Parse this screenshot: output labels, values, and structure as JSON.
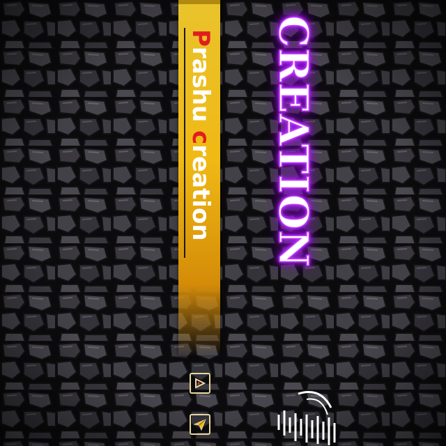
{
  "banner": {
    "title_cap1": "P",
    "title_rest1": "rashu ",
    "title_cap2": "c",
    "title_rest2": "reation"
  },
  "neon": {
    "text": "CREATION"
  },
  "icons": {
    "first": "play-triangle-icon",
    "second": "paper-plane-icon"
  },
  "colors": {
    "banner_yellow": "#f0b914",
    "accent_red": "#e11d1d",
    "neon_purple": "#b020ff",
    "stone_dark": "#0c0c0e"
  }
}
